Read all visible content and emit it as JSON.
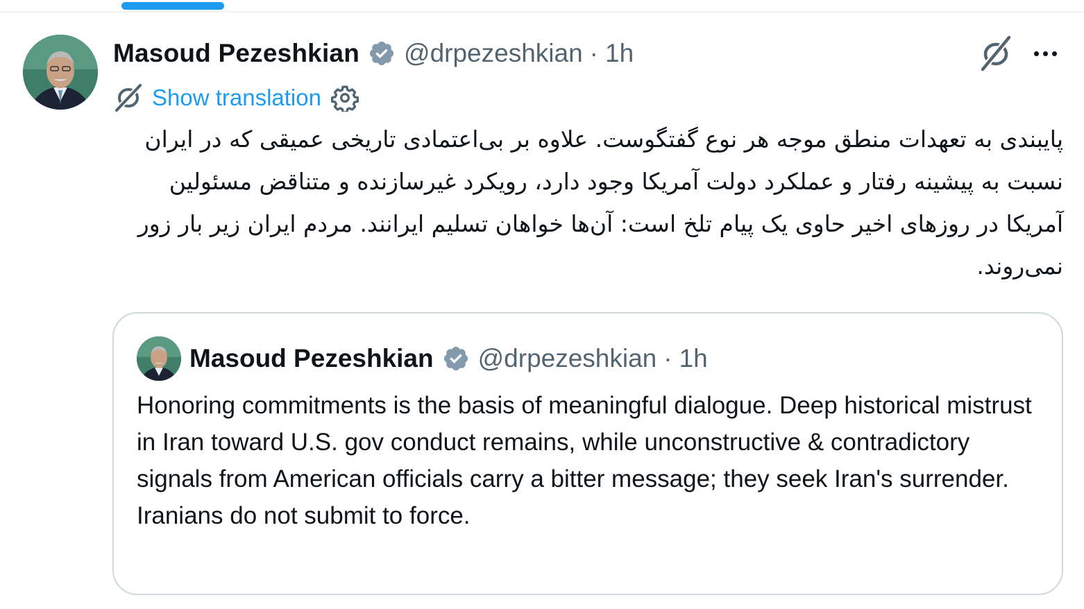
{
  "colors": {
    "accent": "#1d9bf0",
    "verified": "#829aab",
    "secondary_text": "#536471",
    "primary_text": "#0f1419",
    "border": "#cfd9de"
  },
  "tab_bar": {
    "active_indicator_color": "#1d9bf0"
  },
  "tweet": {
    "avatar_icon": "avatar",
    "author": {
      "display_name": "Masoud Pezeshkian",
      "handle": "@drpezeshkian",
      "verified_icon": "verified-badge-icon"
    },
    "separator": "·",
    "time": "1h",
    "actions": {
      "grok_icon": "grok-icon",
      "more_icon": "more-icon"
    },
    "translation": {
      "icon": "translate-icon",
      "label": "Show translation",
      "settings_icon": "gear-icon"
    },
    "text": "پایبندی به تعهدات منطق موجه هر نوع گفتگوست. علاوه بر بی‌اعتمادی تاریخی عمیقی که در ایران نسبت به پیشینه رفتار و عملکرد دولت آمریکا وجود دارد، رویکرد غیرسازنده و متناقض مسئولین آمریکا در روزهای اخیر حاوی یک پیام تلخ است: آن‌ها خواهان تسلیم ایرانند. مردم ایران زیر بار زور نمی‌روند."
  },
  "quoted_tweet": {
    "author": {
      "display_name": "Masoud Pezeshkian",
      "handle": "@drpezeshkian",
      "verified_icon": "verified-badge-icon"
    },
    "separator": "·",
    "time": "1h",
    "text": "Honoring commitments is the basis of meaningful dialogue. Deep historical mistrust in Iran toward U.S. gov conduct remains, while unconstructive & contradictory signals from American officials carry a bitter message; they seek Iran's surrender. Iranians do not submit to force."
  }
}
